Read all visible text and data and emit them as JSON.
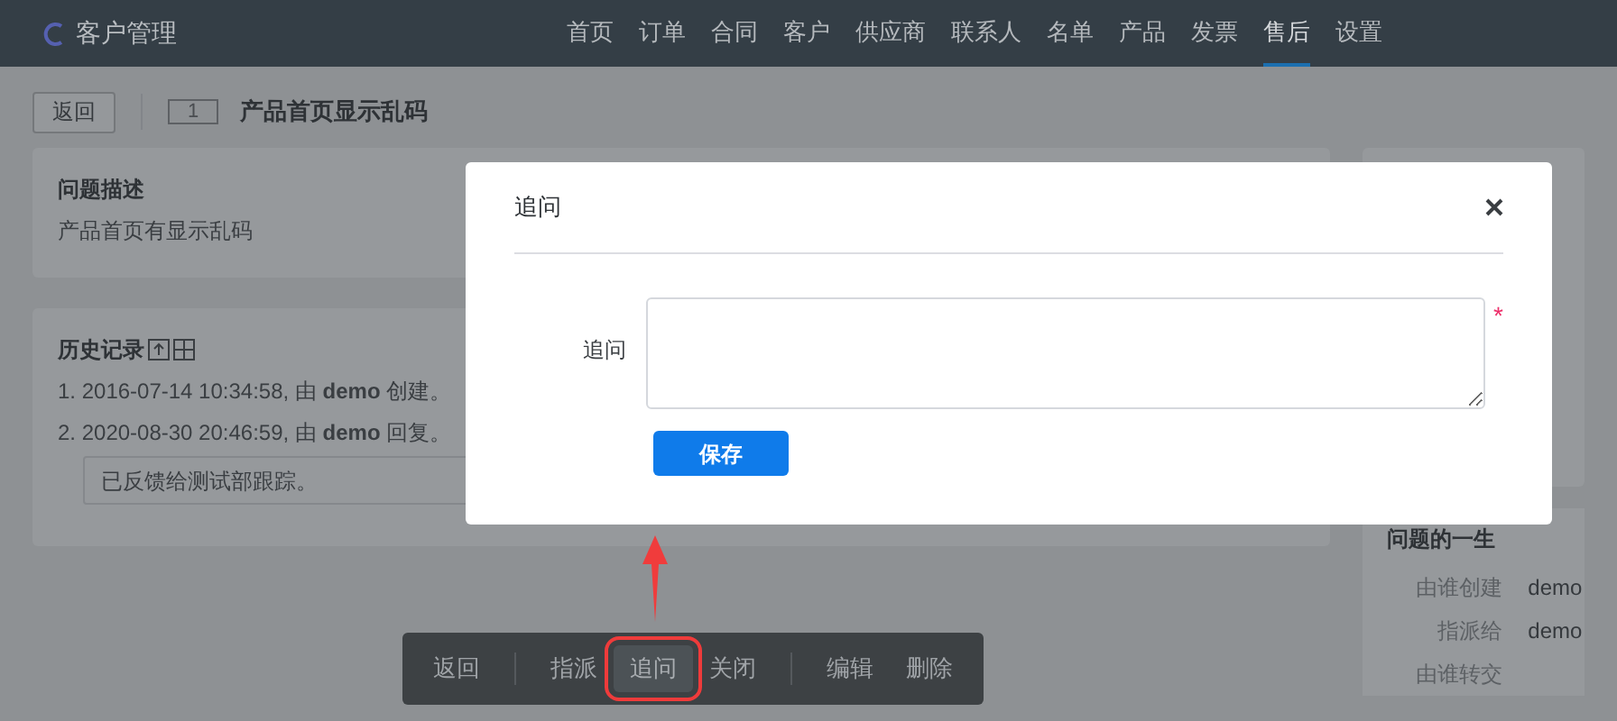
{
  "app": {
    "title": "客户管理"
  },
  "nav": [
    {
      "label": "首页",
      "selected": false
    },
    {
      "label": "订单",
      "selected": false
    },
    {
      "label": "合同",
      "selected": false
    },
    {
      "label": "客户",
      "selected": false
    },
    {
      "label": "供应商",
      "selected": false
    },
    {
      "label": "联系人",
      "selected": false
    },
    {
      "label": "名单",
      "selected": false
    },
    {
      "label": "产品",
      "selected": false
    },
    {
      "label": "发票",
      "selected": false
    },
    {
      "label": "售后",
      "selected": true
    },
    {
      "label": "设置",
      "selected": false
    }
  ],
  "header": {
    "back": "返回",
    "id": "1",
    "title": "产品首页显示乱码"
  },
  "description": {
    "title": "问题描述",
    "text": "产品首页有显示乱码"
  },
  "history": {
    "title": "历史记录",
    "entries": [
      {
        "text": "1. 2016-07-14 10:34:58, 由 **demo** 创建。"
      },
      {
        "text": "2. 2020-08-30 20:46:59, 由 **demo** 回复。",
        "note": "已反馈给测试部跟踪。"
      }
    ]
  },
  "lifecycle": {
    "title": "问题的一生",
    "rows": [
      {
        "label": "由谁创建",
        "value": "demo"
      },
      {
        "label": "指派给",
        "value": "demo"
      },
      {
        "label": "由谁转交"
      }
    ]
  },
  "toolbar": [
    [
      {
        "label": "返回",
        "selected": false
      }
    ],
    [
      {
        "label": "指派",
        "selected": false
      },
      {
        "label": "追问",
        "selected": true
      },
      {
        "label": "关闭",
        "selected": false
      }
    ],
    [
      {
        "label": "编辑",
        "selected": false
      },
      {
        "label": "删除",
        "selected": false
      }
    ]
  ],
  "modal": {
    "title": "追问",
    "field_label": "追问",
    "required": true,
    "required_mark": "*",
    "save": "保存"
  }
}
